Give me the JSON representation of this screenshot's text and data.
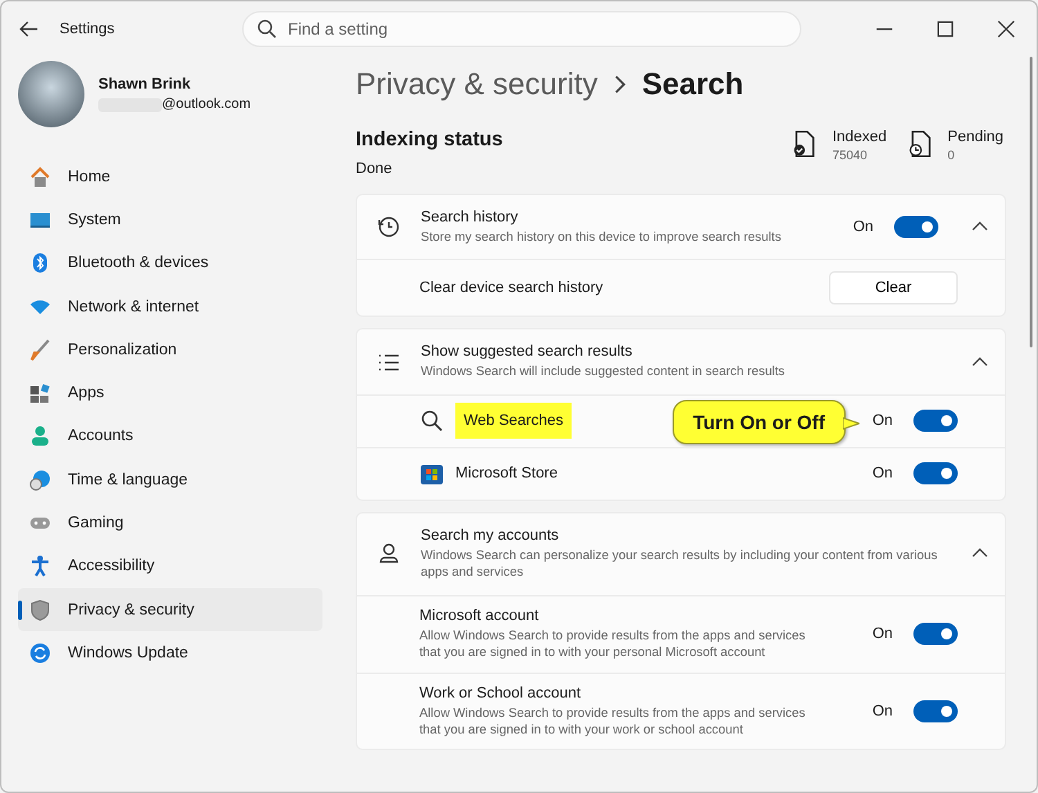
{
  "window": {
    "title": "Settings"
  },
  "search": {
    "placeholder": "Find a setting"
  },
  "account": {
    "name": "Shawn Brink",
    "email": "@outlook.com"
  },
  "sidebar": {
    "items": [
      {
        "label": "Home",
        "selected": false
      },
      {
        "label": "System",
        "selected": false
      },
      {
        "label": "Bluetooth & devices",
        "selected": false
      },
      {
        "label": "Network & internet",
        "selected": false
      },
      {
        "label": "Personalization",
        "selected": false
      },
      {
        "label": "Apps",
        "selected": false
      },
      {
        "label": "Accounts",
        "selected": false
      },
      {
        "label": "Time & language",
        "selected": false
      },
      {
        "label": "Gaming",
        "selected": false
      },
      {
        "label": "Accessibility",
        "selected": false
      },
      {
        "label": "Privacy & security",
        "selected": true
      },
      {
        "label": "Windows Update",
        "selected": false
      }
    ]
  },
  "breadcrumb": [
    "Privacy & security",
    "Search"
  ],
  "indexing": {
    "title": "Indexing status",
    "status": "Done",
    "stats": [
      {
        "label": "Indexed",
        "value": "75040"
      },
      {
        "label": "Pending",
        "value": "0"
      }
    ]
  },
  "sections": [
    {
      "title": "Search history",
      "description": "Store my search history on this device to improve search results",
      "toggle": {
        "text": "On",
        "on": true
      },
      "expanded": true,
      "rows": [
        {
          "kind": "button",
          "label": "Clear device search history",
          "button": "Clear"
        }
      ]
    },
    {
      "title": "Show suggested search results",
      "description": "Windows Search will include suggested content in search results",
      "expanded": true,
      "rows": [
        {
          "kind": "toggle",
          "label": "Web Searches",
          "highlighted": true,
          "callout": "Turn On or Off",
          "toggle": {
            "text": "On",
            "on": true
          }
        },
        {
          "kind": "toggle",
          "label": "Microsoft Store",
          "highlighted": false,
          "toggle": {
            "text": "On",
            "on": true
          }
        }
      ]
    },
    {
      "title": "Search my accounts",
      "description": "Windows Search can personalize your search results by including your content from various apps and services",
      "expanded": true,
      "rows": [
        {
          "kind": "toggle",
          "label": "Microsoft account",
          "description": "Allow Windows Search to provide results from the apps and services that you are signed in to with your personal Microsoft account",
          "toggle": {
            "text": "On",
            "on": true
          }
        },
        {
          "kind": "toggle",
          "label": "Work or School account",
          "description": "Allow Windows Search to provide results from the apps and services that you are signed in to with your work or school account",
          "toggle": {
            "text": "On",
            "on": true
          }
        }
      ]
    }
  ]
}
